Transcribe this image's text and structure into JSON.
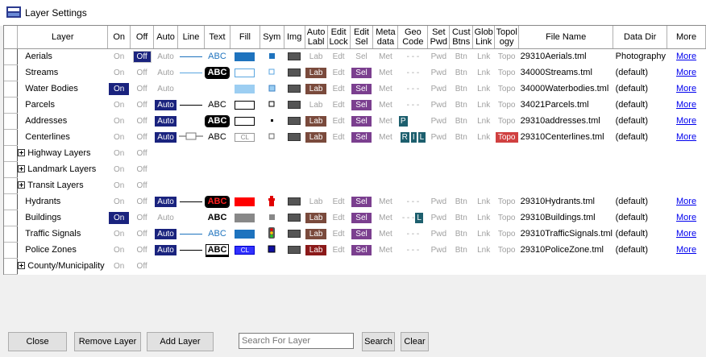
{
  "window": {
    "title": "Layer Settings"
  },
  "columns": [
    "Layer",
    "On",
    "Off",
    "Auto",
    "Line",
    "Text",
    "Fill",
    "Sym",
    "Img",
    "Auto\nLabl",
    "Edit\nLock",
    "Edit\nSel",
    "Meta\ndata",
    "Geo\nCode",
    "Set\nPwd",
    "Cust\nBtns",
    "Glob\nLink",
    "Topol\nogy",
    "File Name",
    "Data Dir",
    "More"
  ],
  "labels": {
    "on": "On",
    "off": "Off",
    "auto": "Auto",
    "lab": "Lab",
    "edit": "Edt",
    "sel": "Sel",
    "met": "Met",
    "pwd": "Pwd",
    "btn": "Btn",
    "lnk": "Lnk",
    "topo": "Topo",
    "abc": "ABC",
    "cl": "CL",
    "dash": "- - -",
    "more": "More",
    "geo_p": "P",
    "geo_r": "R",
    "geo_i": "I",
    "geo_l": "L"
  },
  "rows": [
    {
      "type": "layer",
      "name": "Aerials",
      "on": false,
      "off": true,
      "auto": false,
      "line": "blue",
      "text": "plain-blue",
      "fill": "#1e73be",
      "fill_border": "#1e73be",
      "sym": "blue-sq",
      "lab": false,
      "sel": false,
      "geo": [],
      "topo": false,
      "file": "29310Aerials.tml",
      "dir": "Photography"
    },
    {
      "type": "layer",
      "name": "Streams",
      "on": false,
      "off": false,
      "auto": false,
      "line": "lightblue",
      "text": "halo",
      "fill": "#ffffff",
      "fill_border": "#5aa6e0",
      "sym": "outline-lightblue",
      "lab": true,
      "sel": true,
      "geo": [],
      "topo": false,
      "file": "34000Streams.tml",
      "dir": "(default)"
    },
    {
      "type": "layer",
      "name": "Water Bodies",
      "on": true,
      "off": false,
      "auto": false,
      "line": "none",
      "text": "none",
      "fill": "#9ccef2",
      "fill_border": "#9ccef2",
      "sym": "lightblue-sq",
      "lab": true,
      "sel": true,
      "geo": [],
      "topo": false,
      "file": "34000Waterbodies.tml",
      "dir": "(default)"
    },
    {
      "type": "layer",
      "name": "Parcels",
      "on": false,
      "off": false,
      "auto": true,
      "line": "black",
      "text": "plain-black",
      "fill": "#ffffff",
      "fill_border": "#000000",
      "sym": "outline-black",
      "lab": false,
      "sel": true,
      "geo": [],
      "topo": false,
      "file": "34021Parcels.tml",
      "dir": "(default)"
    },
    {
      "type": "layer",
      "name": "Addresses",
      "on": false,
      "off": false,
      "auto": true,
      "line": "none",
      "text": "halo",
      "fill": "#ffffff",
      "fill_border": "#000000",
      "sym": "dot",
      "lab": true,
      "sel": true,
      "geo": [
        "p"
      ],
      "topo": false,
      "file": "29310addresses.tml",
      "dir": "(default)"
    },
    {
      "type": "layer",
      "name": "Centerlines",
      "on": false,
      "off": false,
      "auto": true,
      "line": "cl",
      "text": "plain-black",
      "fill": "cl",
      "fill_border": "#888888",
      "sym": "outline-gray",
      "lab": true,
      "sel": true,
      "geo": [
        "r",
        "i",
        "l"
      ],
      "topo": true,
      "file": "29310Centerlines.tml",
      "dir": "(default)"
    },
    {
      "type": "group",
      "name": "Highway Layers"
    },
    {
      "type": "group",
      "name": "Landmark Layers"
    },
    {
      "type": "group",
      "name": "Transit Layers"
    },
    {
      "type": "layer",
      "name": "Hydrants",
      "on": false,
      "off": false,
      "auto": true,
      "line": "black",
      "text": "halo-red",
      "fill": "#ff0000",
      "fill_border": "#ff0000",
      "sym": "hydrant",
      "lab": false,
      "sel": true,
      "geo": [],
      "topo": false,
      "file": "29310Hydrants.tml",
      "dir": "(default)"
    },
    {
      "type": "layer",
      "name": "Buildings",
      "on": true,
      "off": false,
      "auto": false,
      "line": "none",
      "text": "bold-black",
      "fill": "#888888",
      "fill_border": "#888888",
      "sym": "gray-sq",
      "lab": true,
      "sel": true,
      "geo": [
        "l"
      ],
      "topo": false,
      "file": "29310Buildings.tml",
      "dir": "(default)"
    },
    {
      "type": "layer",
      "name": "Traffic Signals",
      "on": false,
      "off": false,
      "auto": true,
      "line": "blue",
      "text": "plain-blue",
      "fill": "#1e73be",
      "fill_border": "#1e73be",
      "sym": "signal",
      "lab": true,
      "sel": true,
      "geo": [],
      "topo": false,
      "file": "29310TrafficSignals.tml",
      "dir": "(default)"
    },
    {
      "type": "layer",
      "name": "Police Zones",
      "on": false,
      "off": false,
      "auto": true,
      "line": "black",
      "text": "bold-outline",
      "fill": "cl-blue",
      "fill_border": "#0000cc",
      "sym": "navy-sq",
      "lab": "red",
      "sel": true,
      "geo": [],
      "topo": false,
      "file": "29310PoliceZone.tml",
      "dir": "(default)"
    },
    {
      "type": "group",
      "name": "County/Municipality"
    }
  ],
  "toolbar": {
    "close": "Close",
    "remove": "Remove Layer",
    "add": "Add Layer",
    "search_placeholder": "Search For Layer",
    "search": "Search",
    "clear": "Clear"
  }
}
